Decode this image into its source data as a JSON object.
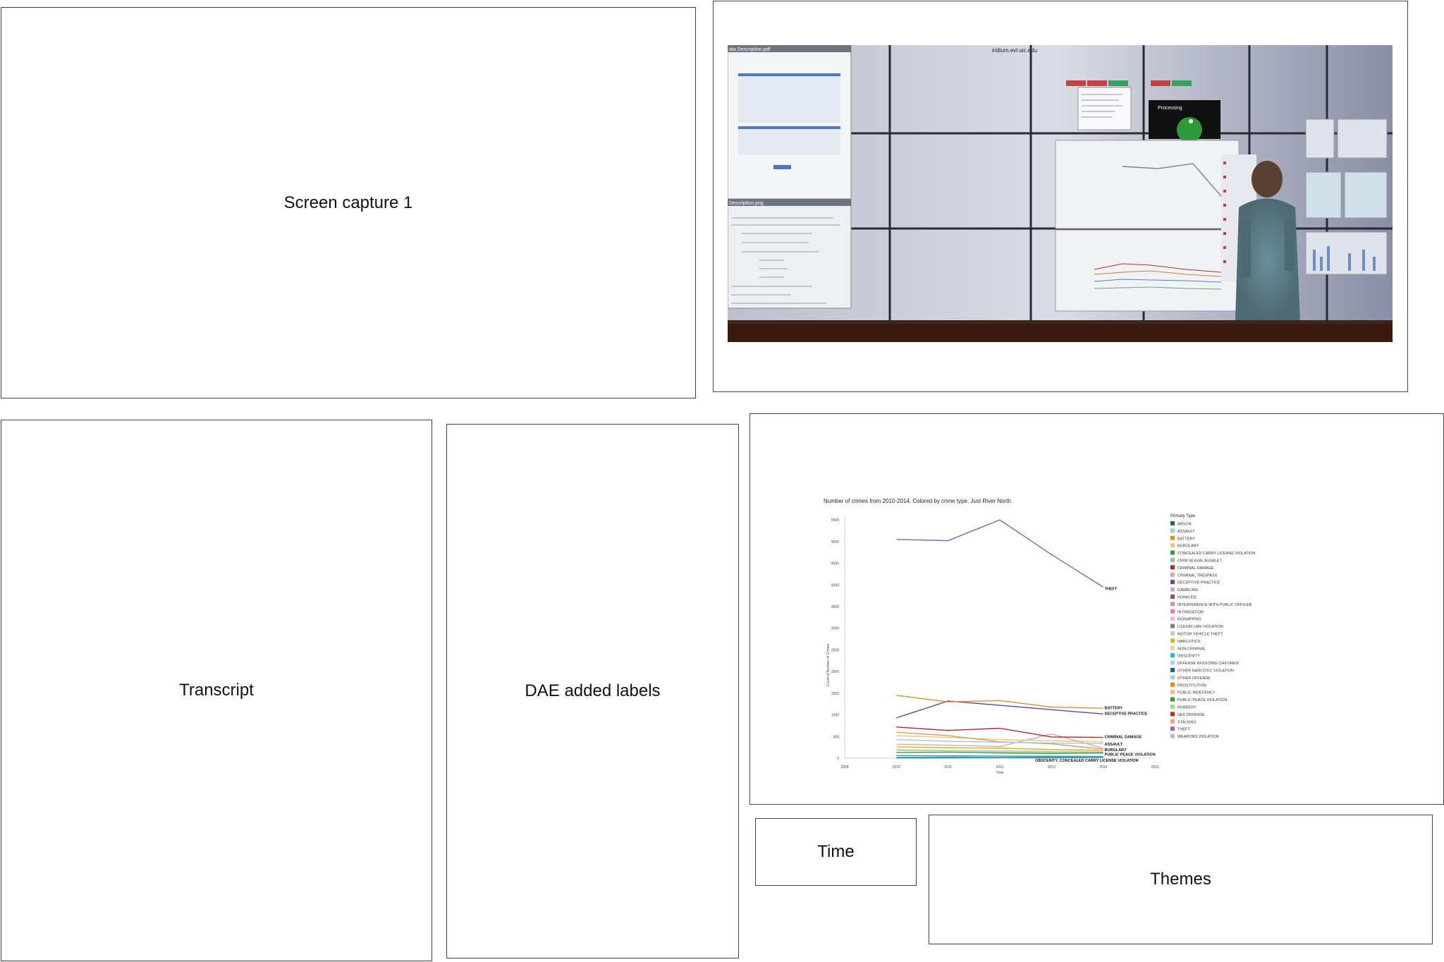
{
  "panels": {
    "screen_capture": "Screen capture 1",
    "transcript": "Transcript",
    "dae_labels": "DAE added labels",
    "time": "Time",
    "themes": "Themes"
  },
  "photo": {
    "description_tab": "Description.png",
    "pdf_tab": "ata Description.pdf",
    "host": "iridium.evl.uic.edu",
    "processing": "Processing"
  },
  "colors": {
    "theft": "#8e5fb8",
    "battery": "#e48a2c",
    "deceptive": "#7a4fb0",
    "criminal_damage": "#b3262e",
    "assault": "#9ecae1"
  },
  "chart_data": {
    "type": "line",
    "title": "Number of crimes from 2010-2014.  Colored by crime type.  Just River North.",
    "xlabel": "Time",
    "ylabel": "Count of Number of Crimes",
    "x_ticks": [
      "2009",
      "2010",
      "2011",
      "2012",
      "2013",
      "2014",
      "2015"
    ],
    "y_ticks": [
      "0",
      "500",
      "1000",
      "1500",
      "2000",
      "2500",
      "3000",
      "3500",
      "4000",
      "4500",
      "5000",
      "5500"
    ],
    "xlim": [
      2009,
      2015
    ],
    "ylim": [
      0,
      5600
    ],
    "x": [
      2010,
      2011,
      2012,
      2013,
      2014
    ],
    "series": [
      {
        "name": "THEFT",
        "color": "#8e5fb8",
        "values": [
          5050,
          5020,
          5500,
          4700,
          3950
        ]
      },
      {
        "name": "BATTERY",
        "color": "#e48a2c",
        "values": [
          1450,
          1300,
          1330,
          1180,
          1150
        ]
      },
      {
        "name": "DECEPTIVE PRACTICE",
        "color": "#6a3fa8",
        "values": [
          930,
          1320,
          1220,
          1120,
          1020
        ]
      },
      {
        "name": "CRIMINAL DAMAGE",
        "color": "#b3262e",
        "values": [
          720,
          640,
          690,
          490,
          480
        ]
      },
      {
        "name": "ASSAULT",
        "color": "#9ecae1",
        "values": [
          430,
          390,
          370,
          350,
          340
        ]
      },
      {
        "name": "BURGLARY",
        "color": "#d6a050",
        "values": [
          600,
          520,
          380,
          330,
          210
        ]
      },
      {
        "name": "PUBLIC PEACE VIOLATION",
        "color": "#2a9d5c",
        "values": [
          130,
          140,
          120,
          110,
          120
        ]
      },
      {
        "name": "OBSCENITY",
        "color": "#17becf",
        "values": [
          20,
          25,
          20,
          30,
          20
        ]
      },
      {
        "name": "CONCEALED CARRY LICENSE VIOLATION",
        "color": "#1f77b4",
        "values": [
          5,
          8,
          10,
          12,
          15
        ]
      },
      {
        "name": "CRIMINAL TRESPASS",
        "color": "#f2a0a0",
        "values": [
          320,
          300,
          270,
          560,
          230
        ]
      },
      {
        "name": "OTHER OFFENSE",
        "color": "#e8c870",
        "values": [
          520,
          480,
          430,
          400,
          380
        ]
      },
      {
        "name": "ROBBERY",
        "color": "#bcbd22",
        "values": [
          260,
          240,
          230,
          200,
          180
        ]
      },
      {
        "name": "NARCOTICS",
        "color": "#98df8a",
        "values": [
          180,
          170,
          150,
          140,
          130
        ]
      },
      {
        "name": "MOTOR VEHICLE THEFT",
        "color": "#f7b6d2",
        "values": [
          200,
          180,
          175,
          160,
          150
        ]
      },
      {
        "name": "WEAPONS VIOLATION",
        "color": "#7f7f7f",
        "values": [
          60,
          55,
          50,
          45,
          40
        ]
      }
    ],
    "annotations": [
      "THEFT",
      "BATTERY",
      "DECEPTIVE PRACTICE",
      "CRIMINAL DAMAGE",
      "ASSAULT",
      "BURGLARY",
      "PUBLIC PEACE VIOLATION",
      "OBSCENITY, CONCEALED CARRY LICENSE VIOLATION"
    ],
    "legend_title": "Primary Type",
    "legend": [
      {
        "name": "ARSON",
        "color": "#2c5e8c"
      },
      {
        "name": "ASSAULT",
        "color": "#9ecae1"
      },
      {
        "name": "BATTERY",
        "color": "#e48a2c"
      },
      {
        "name": "BURGLARY",
        "color": "#f3c08a"
      },
      {
        "name": "CONCEALED CARRY LICENSE VIOLATION",
        "color": "#2a9d5c"
      },
      {
        "name": "CRIM SEXUAL ASSAULT",
        "color": "#8fd18b"
      },
      {
        "name": "CRIMINAL DAMAGE",
        "color": "#b3262e"
      },
      {
        "name": "CRIMINAL TRESPASS",
        "color": "#f2a0a0"
      },
      {
        "name": "DECEPTIVE PRACTICE",
        "color": "#6a3fa8"
      },
      {
        "name": "GAMBLING",
        "color": "#c5b0d5"
      },
      {
        "name": "HOMICIDE",
        "color": "#8c564b"
      },
      {
        "name": "INTERFERENCE WITH PUBLIC OFFICER",
        "color": "#c49c94"
      },
      {
        "name": "INTIMIDATION",
        "color": "#e377c2"
      },
      {
        "name": "KIDNAPPING",
        "color": "#f7b6d2"
      },
      {
        "name": "LIQUOR LAW VIOLATION",
        "color": "#7f7f7f"
      },
      {
        "name": "MOTOR VEHICLE THEFT",
        "color": "#c7c7c7"
      },
      {
        "name": "NARCOTICS",
        "color": "#bcbd22"
      },
      {
        "name": "NON-CRIMINAL",
        "color": "#dbdb8d"
      },
      {
        "name": "OBSCENITY",
        "color": "#17becf"
      },
      {
        "name": "OFFENSE INVOLVING CHILDREN",
        "color": "#9edae5"
      },
      {
        "name": "OTHER NARCOTIC VIOLATION",
        "color": "#1f5f9f"
      },
      {
        "name": "OTHER OFFENSE",
        "color": "#aec7e8"
      },
      {
        "name": "PROSTITUTION",
        "color": "#ff7f0e"
      },
      {
        "name": "PUBLIC INDECENCY",
        "color": "#ffbb78"
      },
      {
        "name": "PUBLIC PEACE VIOLATION",
        "color": "#2ca02c"
      },
      {
        "name": "ROBBERY",
        "color": "#98df8a"
      },
      {
        "name": "SEX OFFENSE",
        "color": "#d62728"
      },
      {
        "name": "STALKING",
        "color": "#ff9896"
      },
      {
        "name": "THEFT",
        "color": "#9467bd"
      },
      {
        "name": "WEAPONS VIOLATION",
        "color": "#c5b0d5"
      }
    ]
  }
}
